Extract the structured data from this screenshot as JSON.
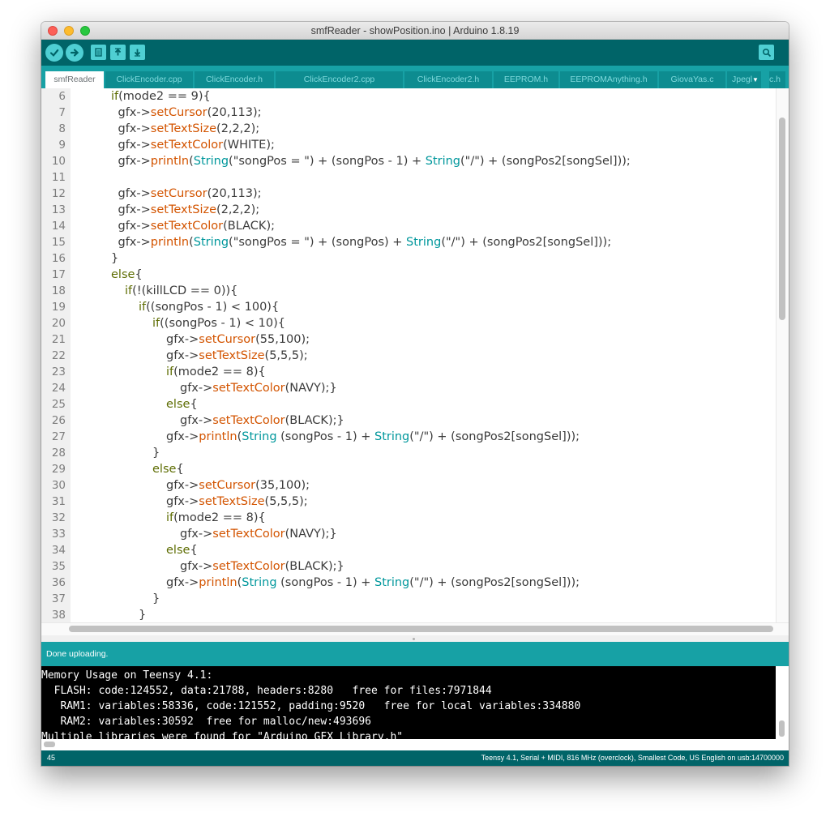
{
  "window": {
    "title": "smfReader - showPosition.ino | Arduino 1.8.19"
  },
  "toolbar": {
    "verify_icon": "checkmark-icon",
    "upload_icon": "arrow-right-icon",
    "new_icon": "new-file-icon",
    "open_icon": "open-up-arrow-icon",
    "save_icon": "save-down-arrow-icon",
    "serial_monitor_icon": "magnifier-icon"
  },
  "tabs": [
    {
      "label": "smfReader"
    },
    {
      "label": "ClickEncoder.cpp"
    },
    {
      "label": "ClickEncoder.h"
    },
    {
      "label": "ClickEncoder2.cpp"
    },
    {
      "label": "ClickEncoder2.h"
    },
    {
      "label": "EEPROM.h"
    },
    {
      "label": "EEPROMAnything.h"
    },
    {
      "label": "GiovaYas.c"
    },
    {
      "label": "Jpegl"
    },
    {
      "label": "c.h"
    }
  ],
  "tab_menu_glyph": "▼",
  "editor": {
    "lines": [
      {
        "num": "6",
        "code": "if(mode2 == 9){"
      },
      {
        "num": "7",
        "code": " gfx->setCursor(20,113);"
      },
      {
        "num": "8",
        "code": " gfx->setTextSize(2,2,2);"
      },
      {
        "num": "9",
        "code": " gfx->setTextColor(WHITE);"
      },
      {
        "num": "10",
        "code": " gfx->println(String(\"songPos = \") + (songPos - 1) + String(\"/\") + (songPos2[songSel]));"
      },
      {
        "num": "11",
        "code": ""
      },
      {
        "num": "12",
        "code": " gfx->setCursor(20,113);"
      },
      {
        "num": "13",
        "code": " gfx->setTextSize(2,2,2);"
      },
      {
        "num": "14",
        "code": " gfx->setTextColor(BLACK);"
      },
      {
        "num": "15",
        "code": " gfx->println(String(\"songPos = \") + (songPos) + String(\"/\") + (songPos2[songSel]));"
      },
      {
        "num": "16",
        "code": "}"
      },
      {
        "num": "17",
        "code": "else{"
      },
      {
        "num": "18",
        "code": "  if(!(killLCD == 0)){"
      },
      {
        "num": "19",
        "code": "    if((songPos - 1) < 100){"
      },
      {
        "num": "20",
        "code": "      if((songPos - 1) < 10){"
      },
      {
        "num": "21",
        "code": "        gfx->setCursor(55,100);"
      },
      {
        "num": "22",
        "code": "        gfx->setTextSize(5,5,5);"
      },
      {
        "num": "23",
        "code": "        if(mode2 == 8){"
      },
      {
        "num": "24",
        "code": "          gfx->setTextColor(NAVY);}"
      },
      {
        "num": "25",
        "code": "        else{"
      },
      {
        "num": "26",
        "code": "          gfx->setTextColor(BLACK);}"
      },
      {
        "num": "27",
        "code": "        gfx->println(String (songPos - 1) + String(\"/\") + (songPos2[songSel]));"
      },
      {
        "num": "28",
        "code": "      }"
      },
      {
        "num": "29",
        "code": "      else{"
      },
      {
        "num": "30",
        "code": "        gfx->setCursor(35,100);"
      },
      {
        "num": "31",
        "code": "        gfx->setTextSize(5,5,5);"
      },
      {
        "num": "32",
        "code": "        if(mode2 == 8){"
      },
      {
        "num": "33",
        "code": "          gfx->setTextColor(NAVY);}"
      },
      {
        "num": "34",
        "code": "        else{"
      },
      {
        "num": "35",
        "code": "          gfx->setTextColor(BLACK);}"
      },
      {
        "num": "36",
        "code": "        gfx->println(String (songPos - 1) + String(\"/\") + (songPos2[songSel]));"
      },
      {
        "num": "37",
        "code": "      }"
      },
      {
        "num": "38",
        "code": "    }"
      }
    ]
  },
  "status": {
    "message": "Done uploading."
  },
  "console": {
    "lines": [
      "Memory Usage on Teensy 4.1:",
      "  FLASH: code:124552, data:21788, headers:8280   free for files:7971844",
      "   RAM1: variables:58336, code:121552, padding:9520   free for local variables:334880",
      "   RAM2: variables:30592  free for malloc/new:493696",
      "Multiple libraries were found for \"Arduino_GFX_Library.h\""
    ]
  },
  "footer": {
    "line_number": "45",
    "board_info": "Teensy 4.1, Serial + MIDI, 816 MHz (overclock), Smallest Code, US English on usb:14700000"
  },
  "colors": {
    "toolbar": "#006468",
    "tabs_bar": "#17a1a5",
    "function": "#d35400",
    "type": "#00979c",
    "keyword": "#5e6d03"
  }
}
